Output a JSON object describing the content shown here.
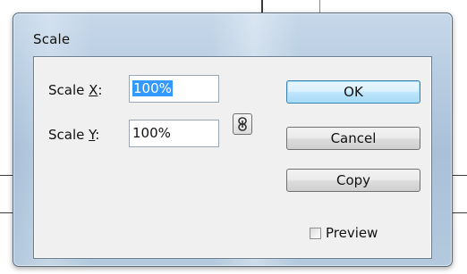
{
  "dialog": {
    "title": "Scale"
  },
  "scale_x": {
    "label_prefix": "Scale ",
    "mnemonic": "X",
    "label_suffix": ":",
    "value": "100%"
  },
  "scale_y": {
    "label_prefix": "Scale ",
    "mnemonic": "Y",
    "label_suffix": ":",
    "value": "100%"
  },
  "constrain_icon": "chain-link-icon",
  "buttons": {
    "ok": "OK",
    "cancel": "Cancel",
    "copy": "Copy"
  },
  "preview": {
    "label": "Preview",
    "checked": false
  },
  "colors": {
    "selection": "#3399ff",
    "default_button_border": "#3c7fb1",
    "background_line_purple": "#b06ad0"
  }
}
